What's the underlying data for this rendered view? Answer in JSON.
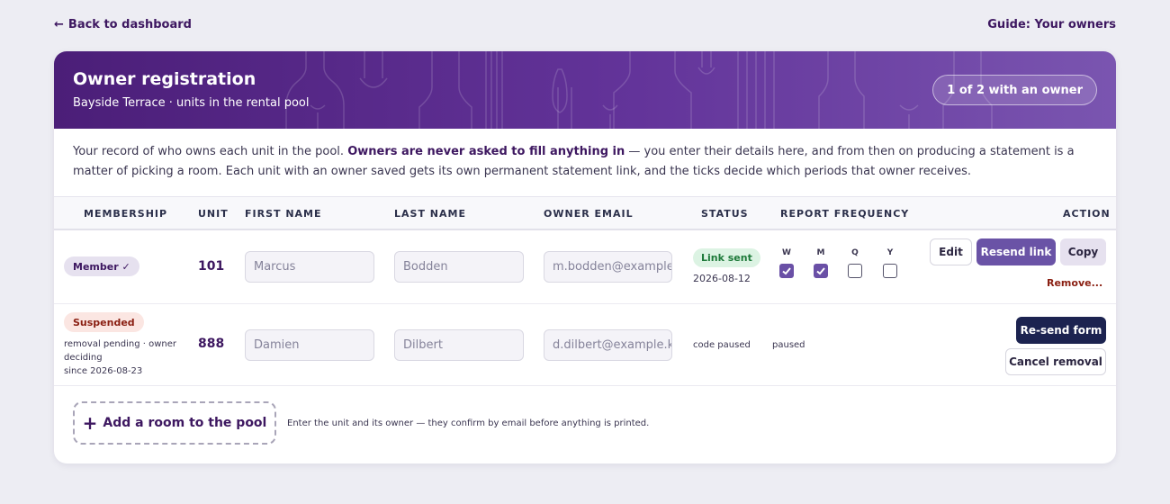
{
  "nav": {
    "back_arrow": "←",
    "back_label": "Back to dashboard",
    "guide_label": "Guide: Your owners"
  },
  "banner": {
    "title": "Owner registration",
    "subtitle": "Bayside Terrace · units in the rental pool",
    "owner_count": "1 of 2 with an owner"
  },
  "intro": {
    "text_before": "Your record of who owns each unit in the pool. ",
    "emphasis": "Owners are never asked to fill anything in",
    "text_after": " — you enter their details here, and from then on producing a statement is a matter of picking a room. Each unit with an owner saved gets its own permanent statement link, and the ticks decide which periods that owner receives."
  },
  "table": {
    "headers": {
      "membership": "MEMBERSHIP",
      "unit": "UNIT",
      "first_name": "FIRST NAME",
      "last_name": "LAST NAME",
      "owner_email": "OWNER EMAIL",
      "status": "STATUS",
      "report_frequency": "REPORT FREQUENCY",
      "action": "ACTION"
    },
    "rows": [
      {
        "membership": "Member ✓",
        "unit": "101",
        "first_name": "Marcus",
        "last_name": "Bodden",
        "email": "m.bodden@example.com",
        "status": "Link sent",
        "status_date": "2026-08-12",
        "frequency": [
          {
            "label": "W",
            "checked": true
          },
          {
            "label": "M",
            "checked": true
          },
          {
            "label": "Q",
            "checked": false
          },
          {
            "label": "Y",
            "checked": false
          }
        ],
        "actions": {
          "edit": "Edit",
          "resend_link": "Resend link",
          "copy": "Copy",
          "remove": "Remove..."
        }
      },
      {
        "membership": "Suspended",
        "note": "removal pending · owner deciding",
        "since": "since 2026-08-23",
        "unit": "888",
        "first_name": "Damien",
        "last_name": "Dilbert",
        "email": "d.dilbert@example.k",
        "status": "code paused",
        "frequency_status": "paused",
        "actions": {
          "resend_form": "Re-send form",
          "cancel_removal": "Cancel removal"
        }
      }
    ]
  },
  "footer": {
    "add_icon": "+",
    "add_label": "Add a room to the pool",
    "hint": "Enter the unit and its owner — they confirm by email before anything is printed."
  },
  "colors": {
    "accent": "#3d1760",
    "banner_start": "#4b1e78",
    "banner_end": "#7a55b0",
    "success": "#1e7a3a",
    "danger": "#8a1f12",
    "navy": "#1c2350"
  }
}
